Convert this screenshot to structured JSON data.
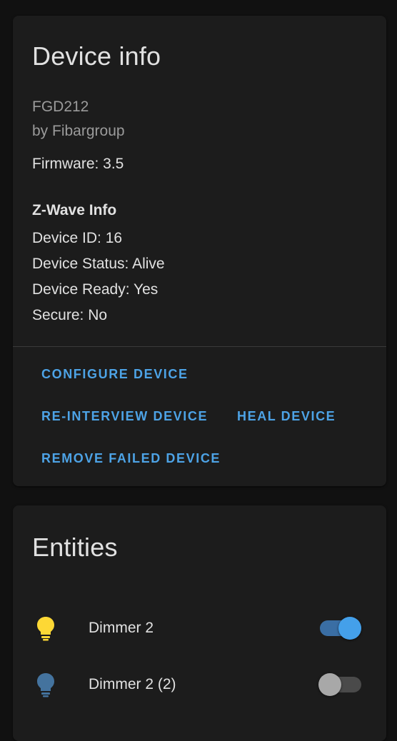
{
  "device_info": {
    "title": "Device info",
    "model": "FGD212",
    "manufacturer": "by Fibargroup",
    "firmware": "Firmware: 3.5",
    "zwave": {
      "heading": "Z-Wave Info",
      "device_id": "Device ID: 16",
      "device_status": "Device Status: Alive",
      "device_ready": "Device Ready: Yes",
      "secure": "Secure: No"
    },
    "actions": {
      "configure": "CONFIGURE DEVICE",
      "reinterview": "RE-INTERVIEW DEVICE",
      "heal": "HEAL DEVICE",
      "remove_failed": "REMOVE FAILED DEVICE"
    }
  },
  "entities": {
    "title": "Entities",
    "items": [
      {
        "name": "Dimmer 2",
        "icon": "lightbulb-icon",
        "state": "on",
        "icon_color": "#fdd835"
      },
      {
        "name": "Dimmer 2 (2)",
        "icon": "lightbulb-icon",
        "state": "off",
        "icon_color": "#44739e"
      }
    ]
  },
  "colors": {
    "accent": "#4da3e6",
    "card_background": "#1c1c1c",
    "page_background": "#111111"
  }
}
